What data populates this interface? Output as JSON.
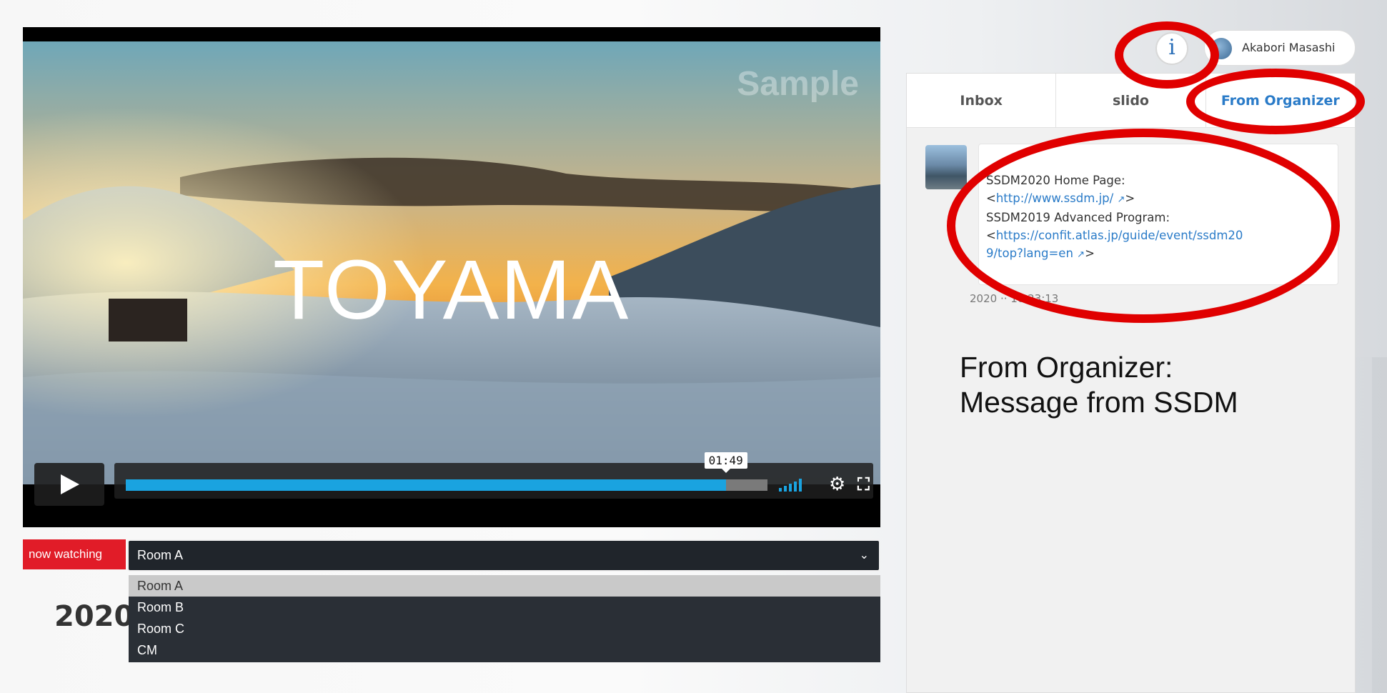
{
  "video": {
    "watermark": "Sample",
    "title": "TOYAMA",
    "current_time": "01:49",
    "progress": 0.935,
    "state": "paused"
  },
  "room": {
    "badge": "now watching",
    "selected": "Room A",
    "options": [
      "Room A",
      "Room B",
      "Room C",
      "CM"
    ]
  },
  "main": {
    "heading_visible": "2020"
  },
  "header": {
    "info_label": "i",
    "user_name": "Akabori Masashi"
  },
  "panel": {
    "tabs": [
      "Inbox",
      "slido",
      "From Organizer"
    ],
    "active_tab": "From Organizer",
    "message": {
      "line1": "SSDM2020 Home Page:",
      "link1": "http://www.ssdm.jp/",
      "line2": "SSDM2019 Advanced Program:",
      "link2a": "https://confit.atlas.jp/guide/event/ssdm20",
      "link2b": "9/top?lang=en",
      "time": "2020 ·· 10 23:13"
    }
  },
  "annotation": {
    "line1": "From Organizer:",
    "line2": "Message from SSDM",
    "color": "#e00000"
  },
  "icons": {
    "play": "play-icon",
    "volume": "volume-icon",
    "settings": "gear-icon",
    "fullscreen": "fullscreen-icon",
    "dropdown": "chevron-down-icon",
    "external": "external-link-icon"
  }
}
